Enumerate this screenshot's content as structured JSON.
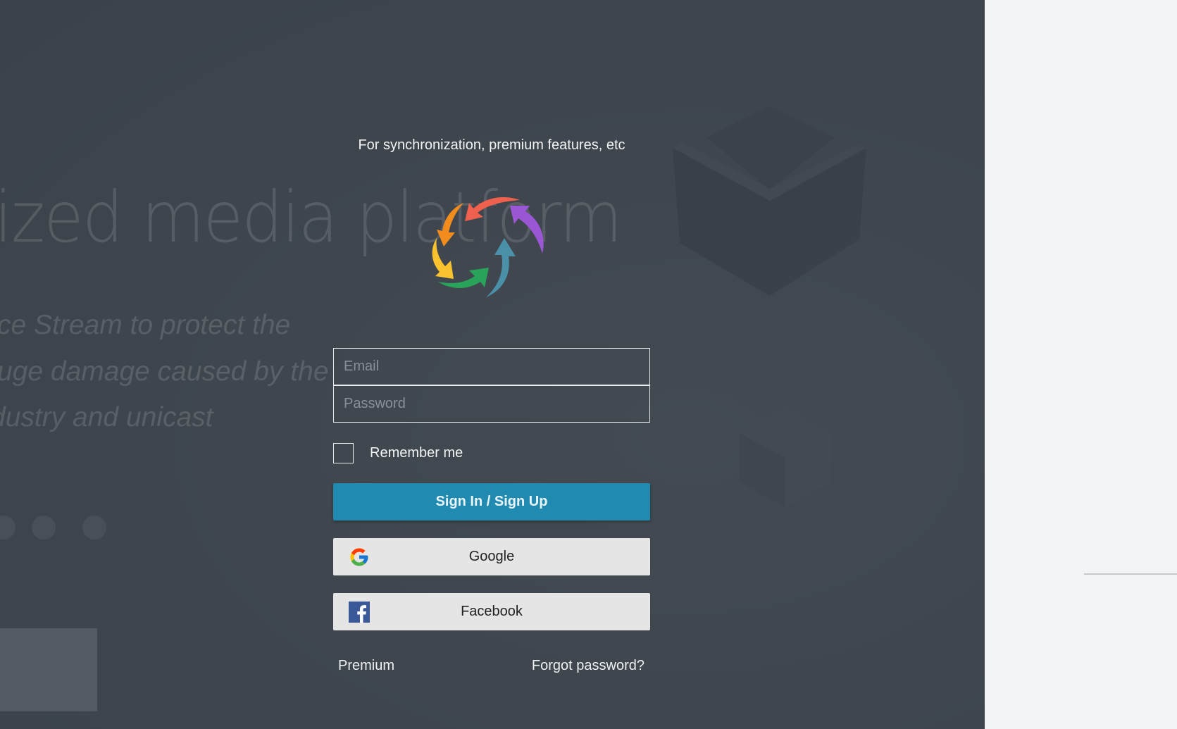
{
  "background": {
    "heading": "ized media platform",
    "lines": [
      "ce Stream to protect the",
      "uge damage caused by the",
      "dustry and unicast"
    ],
    "carousel_dots": 3
  },
  "login": {
    "subtitle": "For synchronization, premium features, etc",
    "email_placeholder": "Email",
    "email_value": "",
    "password_placeholder": "Password",
    "password_value": "",
    "remember_label": "Remember me",
    "remember_checked": false,
    "signin_label": "Sign In / Sign Up",
    "google_label": "Google",
    "facebook_label": "Facebook",
    "premium_link": "Premium",
    "forgot_link": "Forgot password?"
  },
  "colors": {
    "primary_button": "#208ab0",
    "panel_background": "#40474f",
    "right_background": "#f3f4f6",
    "social_button": "#e5e5e5",
    "facebook_blue": "#3b5998"
  },
  "icons": {
    "logo": "sync-arrows-logo",
    "google": "google-g-icon",
    "facebook": "facebook-f-icon"
  }
}
